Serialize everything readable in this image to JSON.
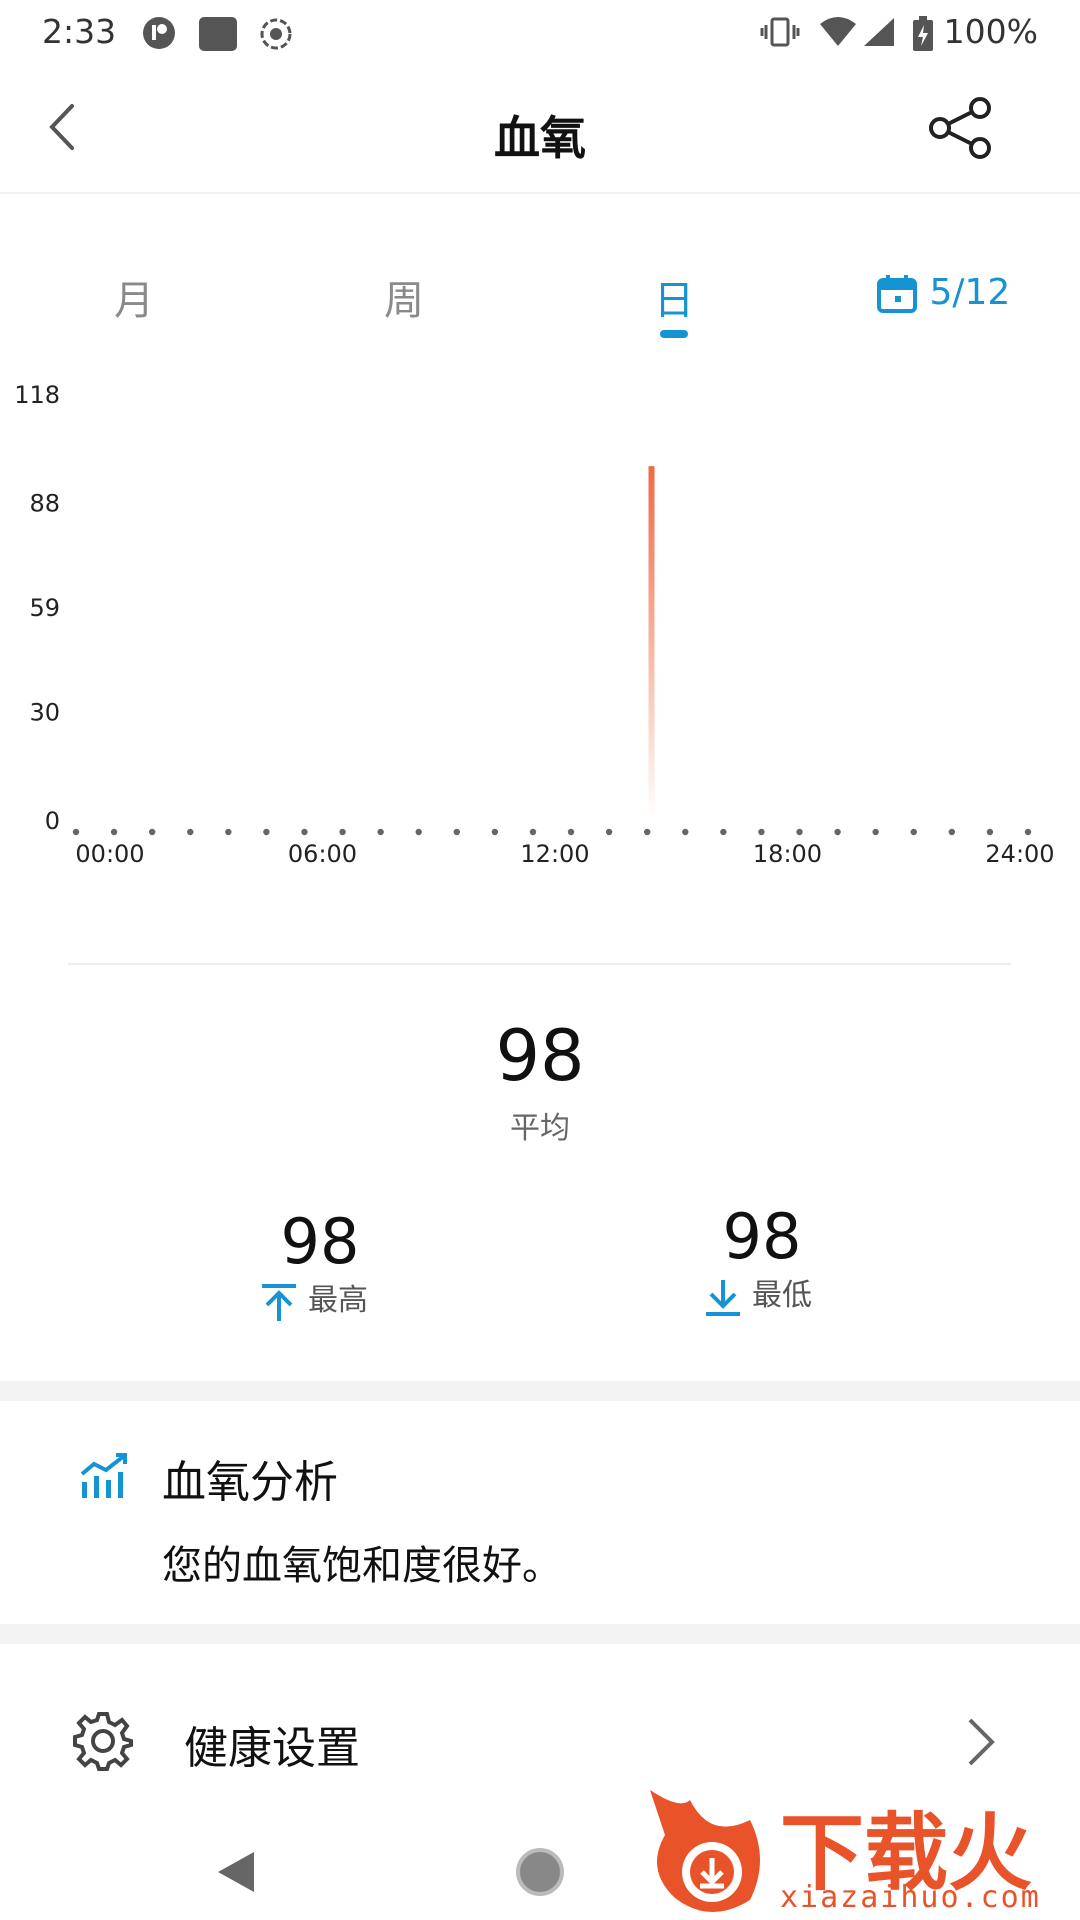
{
  "status_bar": {
    "time": "2:33",
    "battery": "100%"
  },
  "header": {
    "title": "血氧"
  },
  "tabs": [
    {
      "label": "月",
      "active": false
    },
    {
      "label": "周",
      "active": false
    },
    {
      "label": "日",
      "active": true
    }
  ],
  "date_picker": {
    "label": "5/12",
    "icon": "calendar-icon"
  },
  "colors": {
    "accent": "#1693d3",
    "bar": "#ee6a43"
  },
  "chart_data": {
    "type": "bar",
    "y_ticks": [
      "118",
      "88",
      "59",
      "30",
      "0"
    ],
    "ylim": [
      0,
      118
    ],
    "x_ticks": [
      "00:00",
      "06:00",
      "12:00",
      "18:00",
      "24:00"
    ],
    "xlim_hours": [
      0,
      24
    ],
    "points": [
      {
        "time": "14:00",
        "value": 98
      }
    ],
    "grid": "dotted baseline"
  },
  "stats": {
    "average": {
      "value": "98",
      "label": "平均"
    },
    "max": {
      "value": "98",
      "label": "最高"
    },
    "min": {
      "value": "98",
      "label": "最低"
    }
  },
  "analysis": {
    "title": "血氧分析",
    "text": "您的血氧饱和度很好。"
  },
  "settings": {
    "label": "健康设置"
  },
  "watermark": {
    "text": "下载火",
    "domain": "xiazaihuo.com"
  }
}
